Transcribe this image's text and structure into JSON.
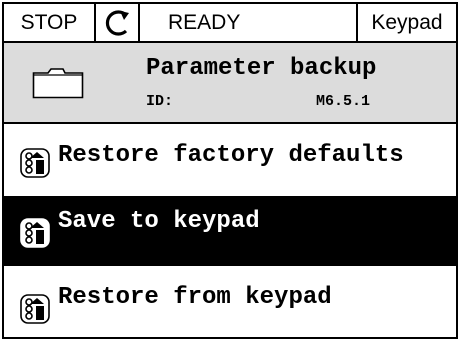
{
  "statusbar": {
    "stop_label": "STOP",
    "rotation_icon": "rotation-direction-icon",
    "state_label": "READY",
    "control_place": "Keypad"
  },
  "header": {
    "icon": "folder-icon",
    "title": "Parameter backup",
    "id_label": "ID:",
    "menu_code": "M6.5.1"
  },
  "menu": {
    "items": [
      {
        "label": "Restore factory defaults",
        "icon": "parameter-icon",
        "selected": false
      },
      {
        "label": "Save to keypad",
        "icon": "parameter-icon",
        "selected": true
      },
      {
        "label": "Restore from keypad",
        "icon": "parameter-icon",
        "selected": false
      }
    ]
  },
  "colors": {
    "header_bg": "#dcdcdc",
    "selected_bg": "#000000",
    "selected_fg": "#ffffff",
    "text": "#000000"
  }
}
